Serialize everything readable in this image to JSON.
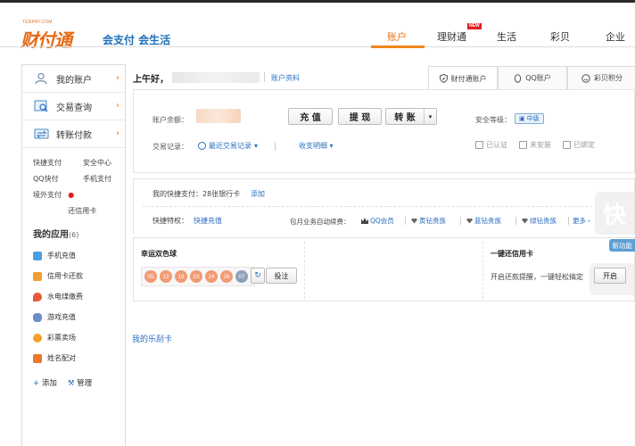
{
  "header": {
    "logo_small": "TENPAY.COM",
    "logo_main": "财付通",
    "logo_slogan": "会支付 会生活",
    "nav": [
      {
        "label": "账户",
        "active": true
      },
      {
        "label": "理财通",
        "badge": "NEW"
      },
      {
        "label": "生活"
      },
      {
        "label": "彩贝"
      },
      {
        "label": "企业"
      }
    ]
  },
  "sidebar": {
    "items": [
      {
        "label": "我的账户",
        "arrow": "›"
      },
      {
        "label": "交易查询",
        "arrow": "›"
      },
      {
        "label": "转账付款",
        "arrow": "›"
      }
    ],
    "quick_links": [
      [
        "快捷支付",
        "安全中心"
      ],
      [
        "QQ快付",
        "手机支付"
      ],
      [
        "境外支付",
        "还信用卡"
      ]
    ],
    "apps_title": "我的应用",
    "apps_count": "(6)",
    "apps": [
      {
        "label": "手机充值",
        "color": "#4a9fe0"
      },
      {
        "label": "信用卡还款",
        "color": "#f0a030"
      },
      {
        "label": "水电煤缴费",
        "color": "#e85a3a"
      },
      {
        "label": "游戏充值",
        "color": "#6a8fc8"
      },
      {
        "label": "彩票卖场",
        "color": "#f2a12a"
      },
      {
        "label": "姓名配对",
        "color": "#e87a2a"
      }
    ],
    "add_label": "添加",
    "manage_label": "管理"
  },
  "greeting": {
    "text": "上午好，",
    "account_link": "账户资料"
  },
  "tabs": [
    {
      "label": "财付通账户",
      "active": true
    },
    {
      "label": "QQ账户"
    },
    {
      "label": "彩贝积分"
    }
  ],
  "balance": {
    "label": "账户余额：",
    "buttons": [
      "充 值",
      "提 现",
      "转 账"
    ],
    "security_label": "安全等级：",
    "security_level": "中级",
    "trade_label": "交易记录：",
    "trade_link": "最近交易记录",
    "income_link": "收支明细",
    "verify": [
      "已认证",
      "未安装",
      "已绑定"
    ]
  },
  "quickpay": {
    "text": "我的快捷支付：28张银行卡",
    "add_label": "添加",
    "priv_label": "快捷特权：",
    "priv_link": "快捷充值",
    "auto_label": "包月业务自动续费：",
    "vips": [
      "QQ会员",
      "黄钻贵族",
      "蓝钻贵族",
      "绿钻贵族",
      "更多"
    ],
    "more_arrow": "›"
  },
  "lottery": {
    "title": "幸运双色球",
    "red_balls": [
      "05",
      "12",
      "19",
      "23",
      "24",
      "26"
    ],
    "blue_ball": "07",
    "refresh": "↻",
    "bet_label": "投注"
  },
  "credit_card": {
    "title": "一键还信用卡",
    "text": "开启还款提醒，一键轻松搞定",
    "open_label": "开启",
    "new_feature": "新功能"
  },
  "lotto_card_link": "我的乐刮卡",
  "watermark": "快"
}
